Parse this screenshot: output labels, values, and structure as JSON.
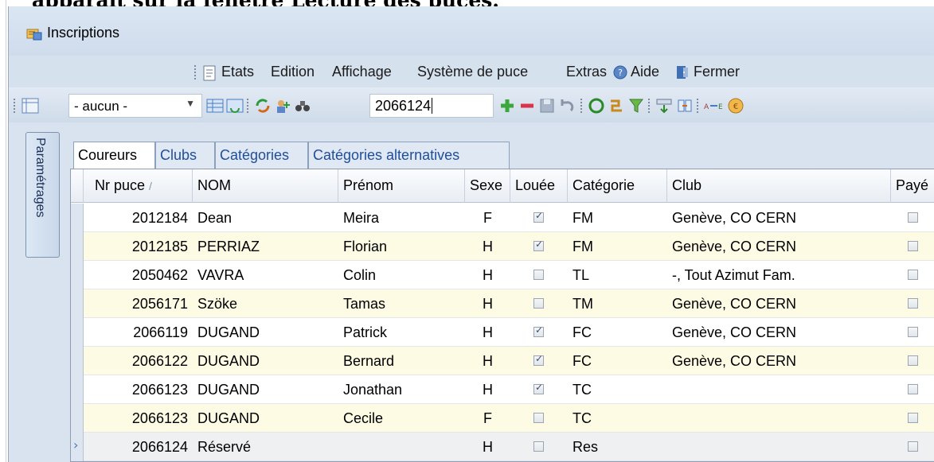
{
  "top_text": "apparaît sur la fenêtre Lecture des puces.",
  "window": {
    "title": "Inscriptions"
  },
  "menu": [
    "Etats",
    "Edition",
    "Affichage",
    "Système de puce",
    "Extras",
    "Aide",
    "Fermer"
  ],
  "toolbar": {
    "filter_value": "- aucun -",
    "search_value": "2066124"
  },
  "side_tab": "Paramétrages",
  "tabs": [
    "Coureurs",
    "Clubs",
    "Catégories",
    "Catégories alternatives"
  ],
  "columns": [
    "Nr puce",
    "NOM",
    "Prénom",
    "Sexe",
    "Louée",
    "Catégorie",
    "Club",
    "Payé"
  ],
  "sort_indicator": "/",
  "rows": [
    {
      "nr": "2012184",
      "nom": "Dean",
      "prenom": "Meira",
      "sexe": "F",
      "louee": true,
      "cat": "FM",
      "club": "Genève, CO CERN",
      "paye": false
    },
    {
      "nr": "2012185",
      "nom": "PERRIAZ",
      "prenom": "Florian",
      "sexe": "H",
      "louee": true,
      "cat": "FM",
      "club": "Genève, CO CERN",
      "paye": false
    },
    {
      "nr": "2050462",
      "nom": "VAVRA",
      "prenom": "Colin",
      "sexe": "H",
      "louee": false,
      "cat": "TL",
      "club": "-, Tout Azimut Fam.",
      "paye": false
    },
    {
      "nr": "2056171",
      "nom": "Szöke",
      "prenom": "Tamas",
      "sexe": "H",
      "louee": false,
      "cat": "TM",
      "club": "Genève, CO CERN",
      "paye": false
    },
    {
      "nr": "2066119",
      "nom": "DUGAND",
      "prenom": "Patrick",
      "sexe": "H",
      "louee": true,
      "cat": "FC",
      "club": "Genève, CO CERN",
      "paye": false
    },
    {
      "nr": "2066122",
      "nom": "DUGAND",
      "prenom": "Bernard",
      "sexe": "H",
      "louee": true,
      "cat": "FC",
      "club": "Genève, CO CERN",
      "paye": false
    },
    {
      "nr": "2066123",
      "nom": "DUGAND",
      "prenom": "Jonathan",
      "sexe": "H",
      "louee": true,
      "cat": "TC",
      "club": "",
      "paye": false
    },
    {
      "nr": "2066123",
      "nom": "DUGAND",
      "prenom": "Cecile",
      "sexe": "F",
      "louee": false,
      "cat": "TC",
      "club": "",
      "paye": false
    },
    {
      "nr": "2066124",
      "nom": "Réservé",
      "prenom": "",
      "sexe": "H",
      "louee": false,
      "cat": "Res",
      "club": "",
      "paye": false
    }
  ],
  "colors": {
    "accent": "#1f4e9c",
    "alt_row": "#fdfbe4",
    "toolbar": "#d6e1ee"
  }
}
